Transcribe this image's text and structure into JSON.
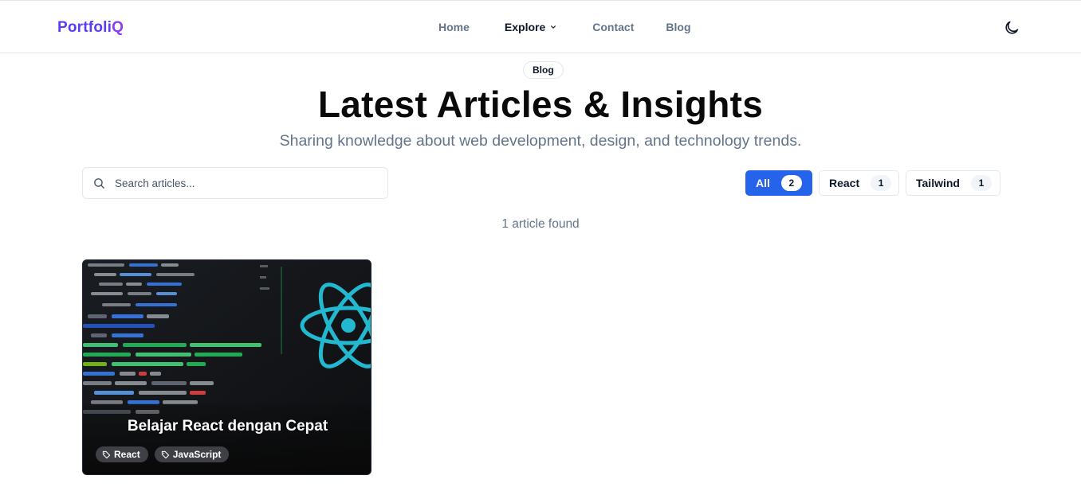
{
  "nav": {
    "brand_main": "Portfoli",
    "brand_accent": "Q",
    "links": {
      "home": "Home",
      "explore": "Explore",
      "contact": "Contact",
      "blog": "Blog"
    },
    "theme_icon": "moon-icon"
  },
  "hero": {
    "badge": "Blog",
    "title": "Latest Articles & Insights",
    "subtitle": "Sharing knowledge about web development, design, and technology trends."
  },
  "search": {
    "placeholder": "Search articles...",
    "value": ""
  },
  "filters": [
    {
      "label": "All",
      "count": "2",
      "active": true
    },
    {
      "label": "React",
      "count": "1",
      "active": false
    },
    {
      "label": "Tailwind",
      "count": "1",
      "active": false
    }
  ],
  "results_text": "1 article found",
  "articles": [
    {
      "title": "Belajar React dengan Cepat",
      "tags": [
        "React",
        "JavaScript"
      ],
      "image": "react-code-screen-image"
    }
  ],
  "colors": {
    "brand": "#5b3df5",
    "accent_active": "#2563eb",
    "muted_text": "#64748b",
    "react_logo": "#22b8cf"
  }
}
